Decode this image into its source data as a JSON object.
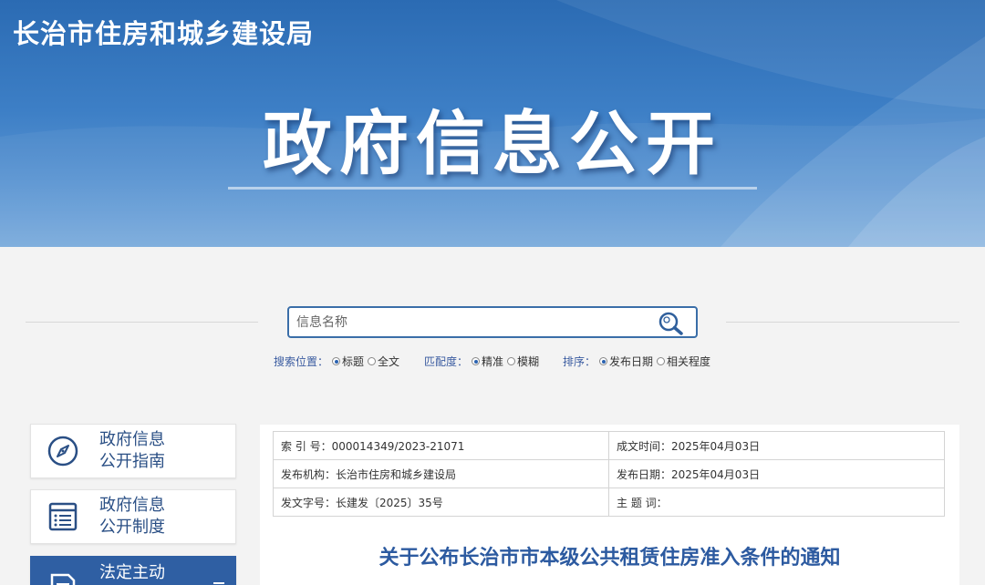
{
  "header": {
    "site_name": "长治市住房和城乡建设局",
    "banner_title": "政府信息公开"
  },
  "search": {
    "placeholder": "信息名称",
    "value": ""
  },
  "options": {
    "scope": {
      "label": "搜索位置：",
      "items": [
        "标题",
        "全文"
      ],
      "selected": "标题"
    },
    "match": {
      "label": "匹配度：",
      "items": [
        "精准",
        "模糊"
      ],
      "selected": "精准"
    },
    "sort": {
      "label": "排序：",
      "items": [
        "发布日期",
        "相关程度"
      ],
      "selected": "发布日期"
    }
  },
  "sidebar": {
    "items": [
      {
        "line1": "政府信息",
        "line2": "公开指南",
        "icon": "compass-icon"
      },
      {
        "line1": "政府信息",
        "line2": "公开制度",
        "icon": "list-icon"
      },
      {
        "line1": "法定主动",
        "line2": "",
        "icon": "document-icon"
      }
    ]
  },
  "meta": {
    "index_no": "索  引  号：000014349/2023-21071",
    "written_date": "成文时间：2025年04月03日",
    "publisher": "发布机构：长治市住房和城乡建设局",
    "publish_date": "发布日期：2025年04月03日",
    "doc_no": "发文字号：长建发〔2025〕35号",
    "subject": "主  题  词："
  },
  "article": {
    "title": "关于公布长治市市本级公共租赁住房准入条件的通知"
  },
  "colors": {
    "banner": "#3d7fc6",
    "accent": "#2c5aa0",
    "active_sidebar": "#2f5fa3"
  }
}
